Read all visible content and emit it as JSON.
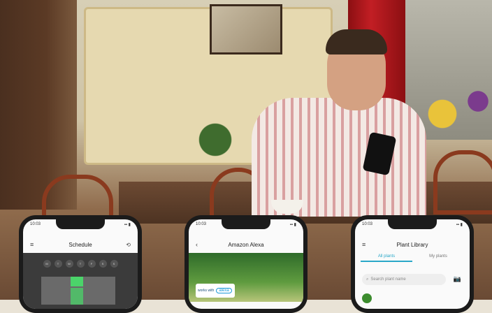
{
  "phones": [
    {
      "time": "10:03",
      "title": "Schedule",
      "menu_icon": "≡",
      "action_icon": "⟲",
      "days": [
        "M",
        "T",
        "W",
        "T",
        "F",
        "S",
        "S"
      ]
    },
    {
      "time": "10:03",
      "title": "Amazon Alexa",
      "back_icon": "‹",
      "badge_works_with": "works with",
      "badge_alexa": "alexa"
    },
    {
      "time": "10:03",
      "title": "Plant Library",
      "menu_icon": "≡",
      "tabs": [
        "All plants",
        "My plants"
      ],
      "search_placeholder": "Search plant name",
      "camera_icon": "📷"
    }
  ],
  "colors": {
    "accent": "#2aa8c8",
    "schedule_highlight": "#4bd46a"
  }
}
